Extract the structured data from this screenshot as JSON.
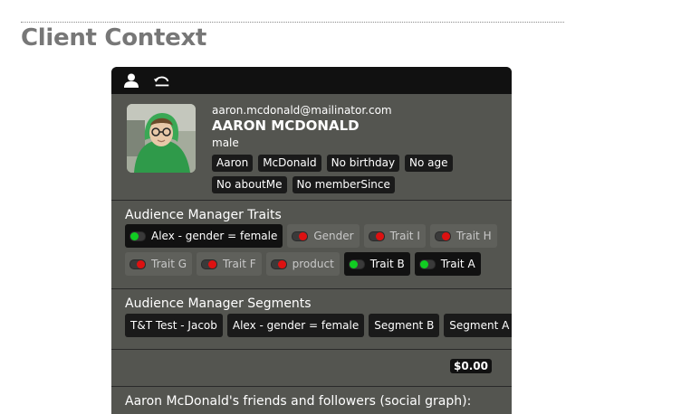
{
  "page": {
    "title": "Client Context"
  },
  "toolbar": {
    "icons": [
      "user-icon",
      "undo-icon"
    ]
  },
  "profile": {
    "email": "aaron.mcdonald@mailinator.com",
    "name": "AARON MCDONALD",
    "gender": "male",
    "chips": [
      "Aaron",
      "McDonald",
      "No birthday",
      "No age",
      "No aboutMe",
      "No memberSince"
    ]
  },
  "traits": {
    "title": "Audience Manager Traits",
    "items": [
      {
        "label": "Alex - gender = female",
        "active": true
      },
      {
        "label": "Gender",
        "active": false
      },
      {
        "label": "Trait I",
        "active": false
      },
      {
        "label": "Trait H",
        "active": false
      },
      {
        "label": "Trait G",
        "active": false
      },
      {
        "label": "Trait F",
        "active": false
      },
      {
        "label": "product",
        "active": false
      },
      {
        "label": "Trait B",
        "active": true
      },
      {
        "label": "Trait A",
        "active": true
      }
    ]
  },
  "segments": {
    "title": "Audience Manager Segments",
    "items": [
      "T&T Test - Jacob",
      "Alex - gender = female",
      "Segment B",
      "Segment A"
    ]
  },
  "revenue": {
    "amount": "$0.00"
  },
  "social": {
    "title": "Aaron McDonald's friends and followers (social graph):"
  },
  "colors": {
    "panel": "#545550",
    "toolbar": "#111111",
    "on": "#11cc22",
    "off": "#dd1111"
  }
}
